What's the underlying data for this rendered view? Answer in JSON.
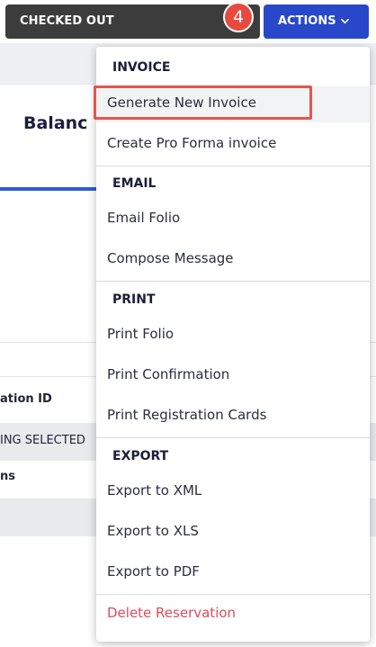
{
  "toolbar": {
    "status_label": "CHECKED OUT",
    "step_number": "4",
    "actions_label": "ACTIONS"
  },
  "background": {
    "balance_fragment": "Balanc",
    "reservation_fragment": "ation ID",
    "nothing_fragment": "ING SELECTED",
    "ns_fragment": "ns"
  },
  "menu": {
    "invoice": {
      "title": "INVOICE",
      "items": [
        "Generate New Invoice",
        "Create Pro Forma invoice"
      ]
    },
    "email": {
      "title": "EMAIL",
      "items": [
        "Email Folio",
        "Compose Message"
      ]
    },
    "print": {
      "title": "PRINT",
      "items": [
        "Print Folio",
        "Print Confirmation",
        "Print Registration Cards"
      ]
    },
    "export": {
      "title": "EXPORT",
      "items": [
        "Export to XML",
        "Export to XLS",
        "Export to PDF"
      ]
    },
    "delete_label": "Delete Reservation"
  },
  "colors": {
    "accent": "#2848c9",
    "danger": "#e04b5a",
    "highlight": "#e2574c"
  }
}
